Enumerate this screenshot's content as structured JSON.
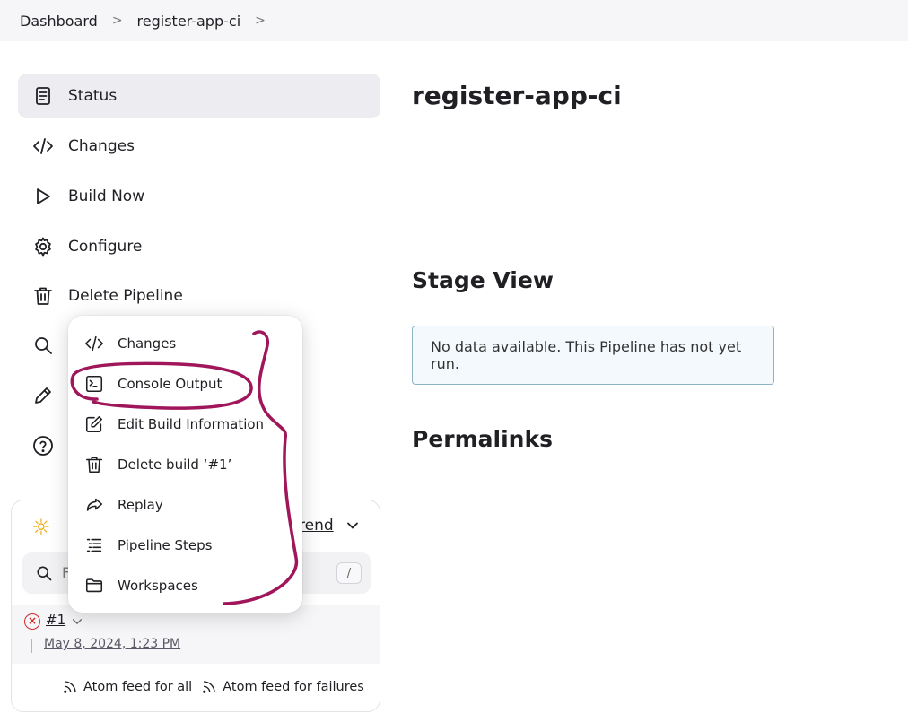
{
  "breadcrumb": {
    "items": [
      "Dashboard",
      "register-app-ci"
    ]
  },
  "sidebar": {
    "items": [
      {
        "label": "Status",
        "icon": "document-icon"
      },
      {
        "label": "Changes",
        "icon": "code-icon"
      },
      {
        "label": "Build Now",
        "icon": "play-icon"
      },
      {
        "label": "Configure",
        "icon": "gear-icon"
      },
      {
        "label": "Delete Pipeline",
        "icon": "trash-icon"
      }
    ],
    "hidden_icons": [
      "search-icon",
      "pencil-icon",
      "help-icon"
    ]
  },
  "build_menu": {
    "items": [
      {
        "label": "Changes",
        "icon": "code-icon"
      },
      {
        "label": "Console Output",
        "icon": "terminal-icon"
      },
      {
        "label": "Edit Build Information",
        "icon": "edit-icon"
      },
      {
        "label": "Delete build ‘#1’",
        "icon": "trash-icon"
      },
      {
        "label": "Replay",
        "icon": "replay-icon"
      },
      {
        "label": "Pipeline Steps",
        "icon": "list-icon"
      },
      {
        "label": "Workspaces",
        "icon": "folder-icon"
      }
    ]
  },
  "build_history": {
    "trend_label": "rend",
    "search_placeholder": "F",
    "search_shortcut": "/",
    "builds": [
      {
        "number": "#1",
        "status": "failed",
        "time": "May 8, 2024, 1:23 PM"
      }
    ],
    "feeds": [
      "Atom feed for all",
      "Atom feed for failures"
    ]
  },
  "main": {
    "title": "register-app-ci",
    "stage_view_title": "Stage View",
    "no_data_message": "No data available. This Pipeline has not yet run.",
    "permalinks_title": "Permalinks"
  },
  "colors": {
    "annotation": "#a0165a",
    "failed": "#d22b2b",
    "no_data_border": "#8db3c7",
    "active_item_bg": "#ececf1"
  }
}
